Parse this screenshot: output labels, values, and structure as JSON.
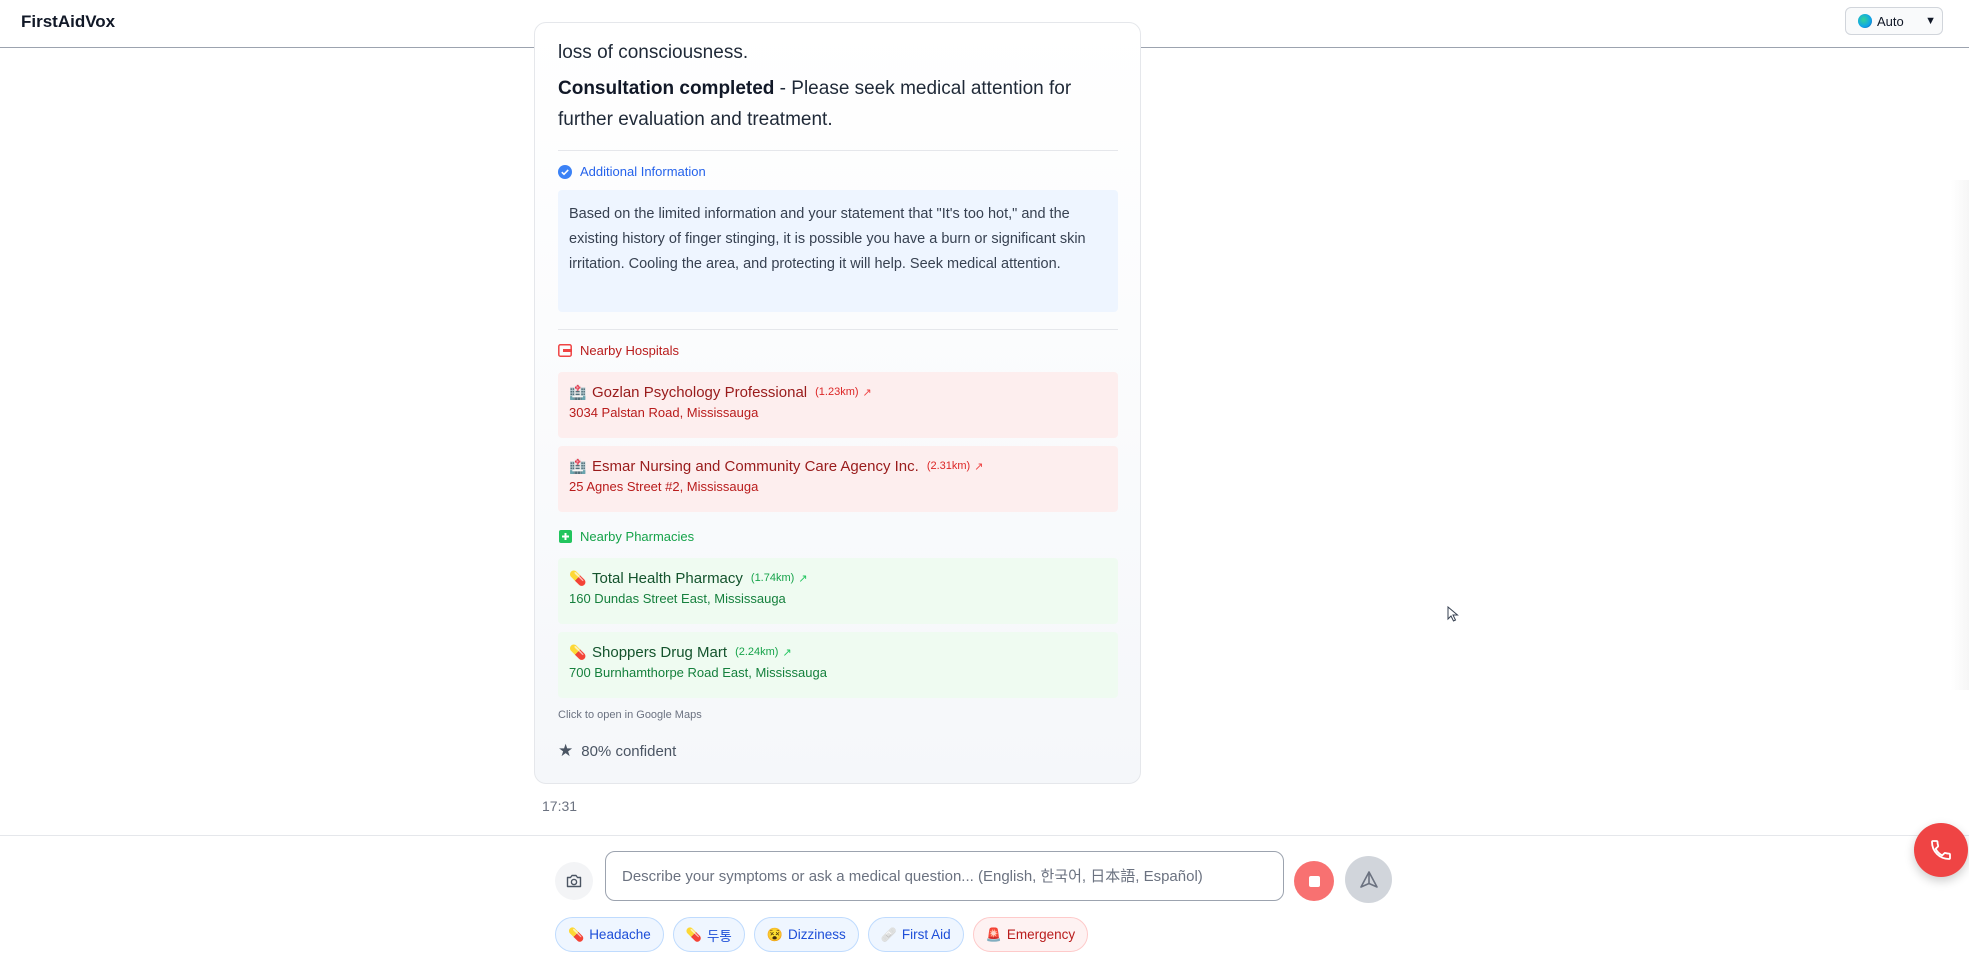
{
  "header": {
    "brand": "FirstAidVox",
    "language": "Auto"
  },
  "chat": {
    "prev_text": "loss of consciousness.",
    "consultation_bold": "Consultation completed",
    "consultation_rest": " - Please seek medical attention for further evaluation and treatment.",
    "additional_info_title": "Additional Information",
    "additional_info_text": "Based on the limited information and your statement that \"It's too hot,\" and the existing history of finger stinging, it is possible you have a burn or significant skin irritation. Cooling the area, and protecting it will help. Seek medical attention.",
    "hospitals_title": "Nearby Hospitals",
    "hospitals": [
      {
        "name": "Gozlan Psychology Professional",
        "distance": "(1.23km)",
        "address": "3034 Palstan Road, Mississauga"
      },
      {
        "name": "Esmar Nursing and Community Care Agency Inc.",
        "distance": "(2.31km)",
        "address": "25 Agnes Street #2, Mississauga"
      }
    ],
    "pharmacies_title": "Nearby Pharmacies",
    "pharmacies": [
      {
        "name": "Total Health Pharmacy",
        "distance": "(1.74km)",
        "address": "160 Dundas Street East, Mississauga"
      },
      {
        "name": "Shoppers Drug Mart",
        "distance": "(2.24km)",
        "address": "700 Burnhamthorpe Road East, Mississauga"
      }
    ],
    "maps_note": "Click to open in Google Maps",
    "confidence": "80% confident",
    "timestamp": "17:31"
  },
  "composer": {
    "placeholder": "Describe your symptoms or ask a medical question... (English, 한국어, 日本語, Español)"
  },
  "quick_chips": [
    {
      "emoji": "💊",
      "label": "Headache"
    },
    {
      "emoji": "💊",
      "label": "두통"
    },
    {
      "emoji": "😵",
      "label": "Dizziness"
    },
    {
      "emoji": "🩹",
      "label": "First Aid"
    },
    {
      "emoji": "🚨",
      "label": "Emergency"
    }
  ],
  "colors": {
    "info_accent": "#2563eb",
    "hospital_accent": "#dc2626",
    "pharmacy_accent": "#16a34a",
    "call_button": "#ef4444"
  }
}
